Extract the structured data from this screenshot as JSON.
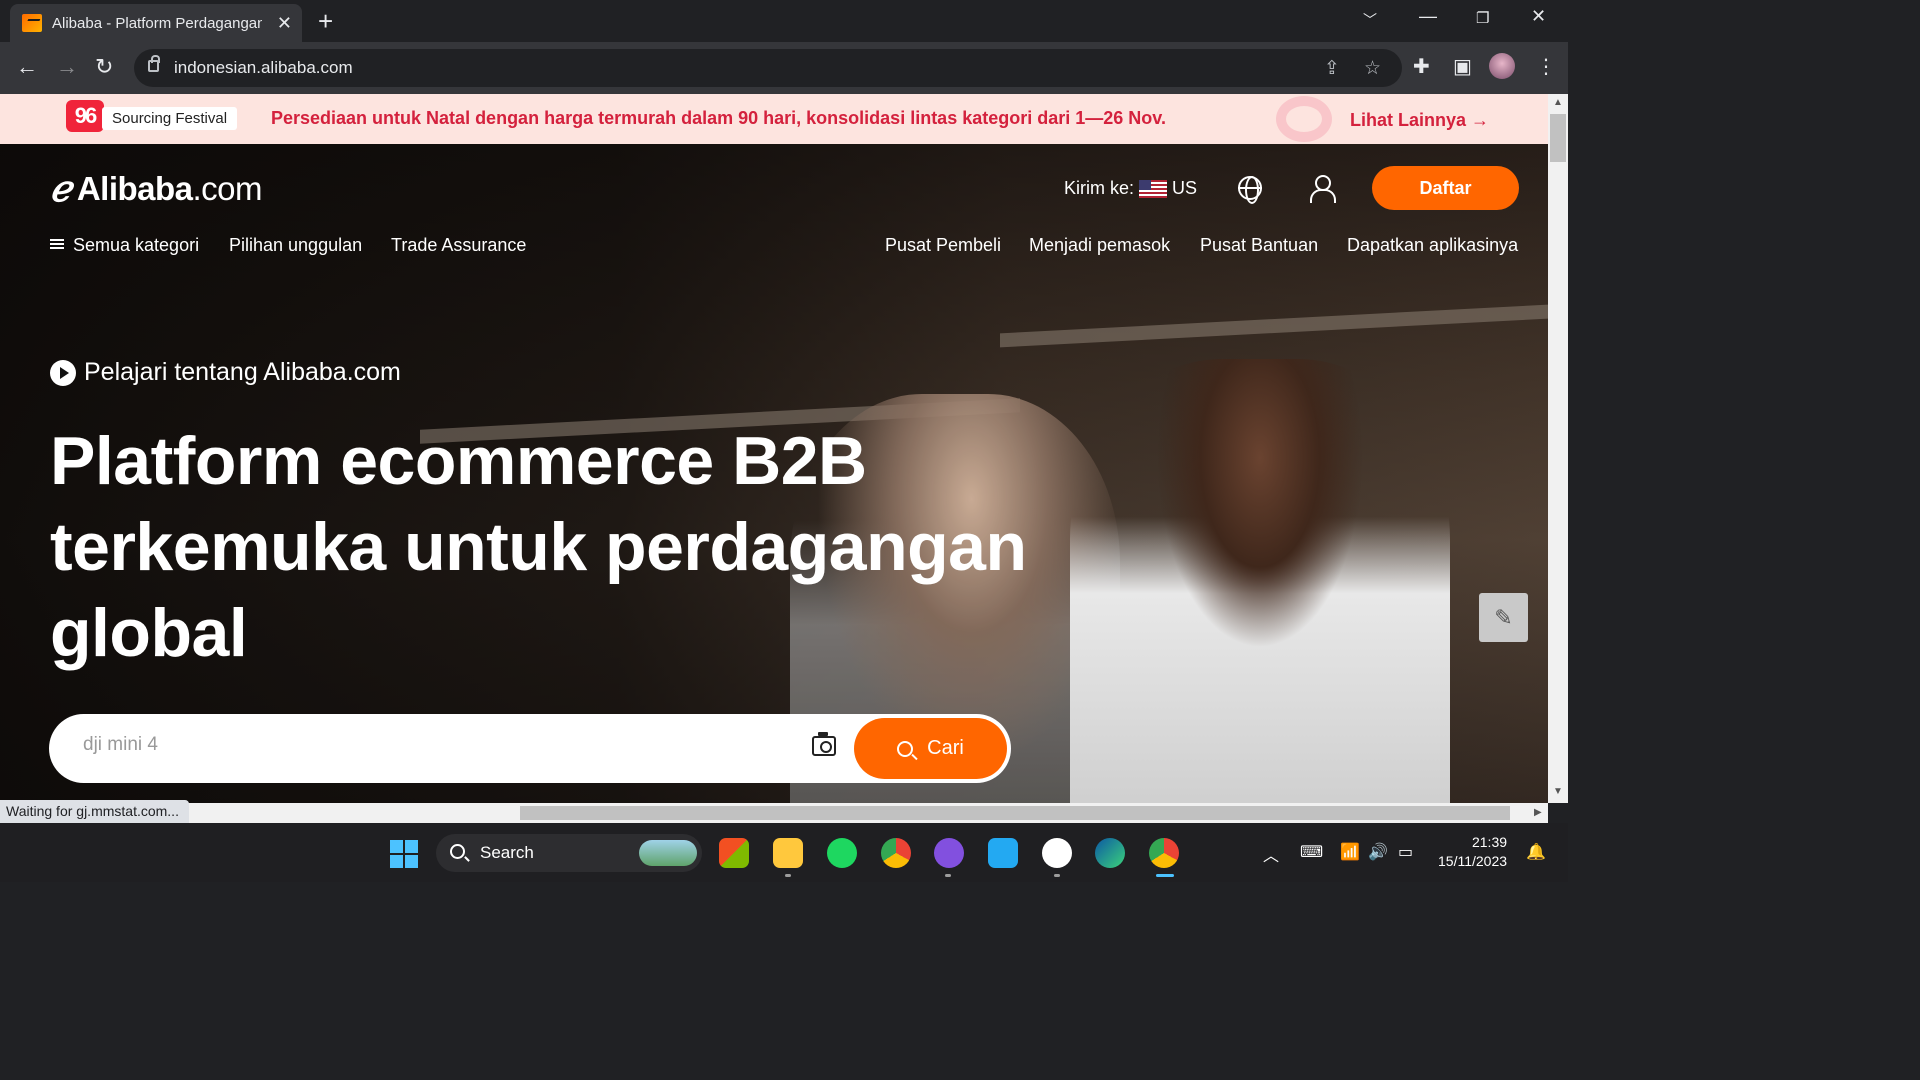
{
  "browser": {
    "tab_title": "Alibaba - Platform Perdagangan",
    "tab_close": "✕",
    "new_tab": "+",
    "url": "indonesian.alibaba.com",
    "status_text": "Waiting for gj.mmstat.com..."
  },
  "banner": {
    "festival_logo": "96",
    "festival_label": "Sourcing Festival",
    "message": "Persediaan untuk Natal dengan harga termurah dalam 90 hari, konsolidasi lintas kategori dari 1—26 Nov.",
    "link": "Lihat Lainnya →"
  },
  "header": {
    "logo_brand": "Alibaba",
    "logo_suffix": ".com",
    "ship_to_label": "Kirim ke:",
    "ship_to_country": "US",
    "signup_button": "Daftar"
  },
  "nav": {
    "left": [
      "Semua kategori",
      "Pilihan unggulan",
      "Trade Assurance"
    ],
    "right": [
      "Pusat Pembeli",
      "Menjadi pemasok",
      "Pusat Bantuan",
      "Dapatkan aplikasinya"
    ]
  },
  "hero": {
    "learn_link": "Pelajari tentang Alibaba.com",
    "headline_line1": "Platform ecommerce B2B",
    "headline_line2": "terkemuka untuk perdagangan",
    "headline_line3": "global",
    "search_placeholder": "dji mini 4",
    "search_button": "Cari"
  },
  "taskbar": {
    "search_label": "Search",
    "time": "21:39",
    "date": "15/11/2023"
  },
  "colors": {
    "accent": "#ff6600",
    "banner_bg": "#fde4df",
    "banner_text": "#d4213d"
  }
}
